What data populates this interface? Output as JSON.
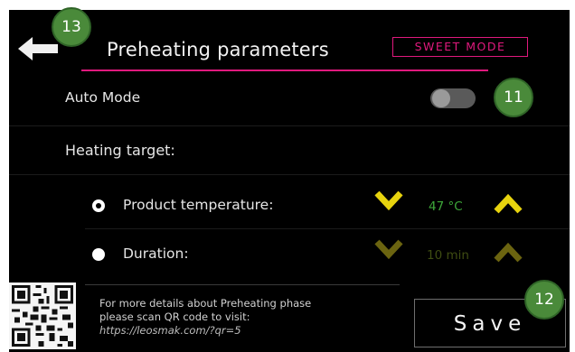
{
  "header": {
    "title": "Preheating parameters",
    "mode_tag": "SWEET MODE",
    "back_icon": "back-arrow-icon",
    "badge": "13"
  },
  "auto_mode": {
    "label": "Auto Mode",
    "toggle_state": "off",
    "badge": "11"
  },
  "heating_target": {
    "label": "Heating target:",
    "options": [
      {
        "label": "Product temperature:",
        "selected": true,
        "value": "47 °C",
        "value_color": "#3ea83a",
        "arrow_color": "#e7d30e"
      },
      {
        "label": "Duration:",
        "selected": false,
        "value": "10 min",
        "value_color": "#3f4d12",
        "arrow_color": "#6b6410"
      }
    ]
  },
  "footer": {
    "line1": "For more details about Preheating phase",
    "line2": "please scan QR code to visit:",
    "url": "https://leosmak.com/?qr=5",
    "qr_icon": "qr-code-icon"
  },
  "save": {
    "label": "Save",
    "badge": "12"
  },
  "colors": {
    "accent": "#e0197d",
    "badge_green": "#4a8a3a",
    "arrow_active": "#e7d30e",
    "arrow_dim": "#6b6410",
    "value_active": "#3ea83a"
  }
}
